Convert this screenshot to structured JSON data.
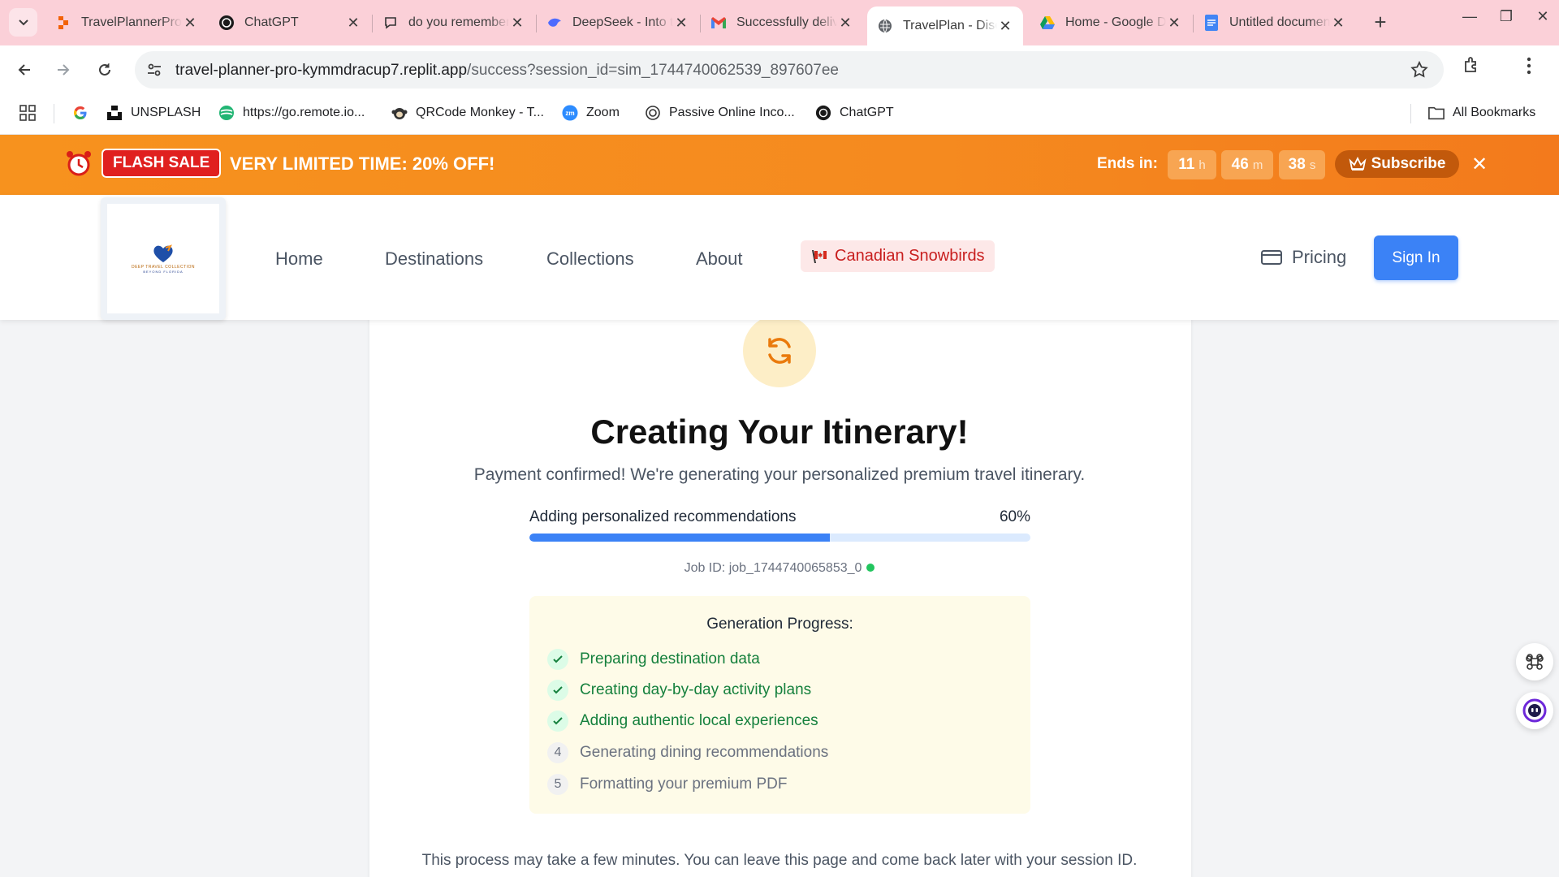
{
  "browser": {
    "tabs": [
      {
        "title": "TravelPlannerPro",
        "favicon": "replit-icon",
        "active": false
      },
      {
        "title": "ChatGPT",
        "favicon": "openai-icon",
        "active": false
      },
      {
        "title": "do you remember",
        "favicon": "chat-icon",
        "active": false
      },
      {
        "title": "DeepSeek - Into the Unknown",
        "favicon": "deepseek-icon",
        "active": false
      },
      {
        "title": "Successfully delivered",
        "favicon": "gmail-icon",
        "active": false
      },
      {
        "title": "TravelPlan - Discover",
        "favicon": "globe-icon",
        "active": true
      },
      {
        "title": "Home - Google Drive",
        "favicon": "drive-icon",
        "active": false
      },
      {
        "title": "Untitled document",
        "favicon": "docs-icon",
        "active": false
      }
    ],
    "url_host": "travel-planner-pro-kymmdracup7.replit.app",
    "url_path": "/success?session_id=sim_1744740062539_897607ee",
    "bookmarks": [
      {
        "label": "",
        "icon": "google-icon"
      },
      {
        "label": "UNSPLASH",
        "icon": "unsplash-icon"
      },
      {
        "label": "https://go.remote.io...",
        "icon": "remote-icon"
      },
      {
        "label": "QRCode Monkey - T...",
        "icon": "qrcode-monkey-icon"
      },
      {
        "label": "Zoom",
        "icon": "zoom-icon"
      },
      {
        "label": "Passive Online Inco...",
        "icon": "openai-icon"
      },
      {
        "label": "ChatGPT",
        "icon": "openai-icon"
      }
    ],
    "all_bookmarks": "All Bookmarks"
  },
  "flash": {
    "badge": "FLASH SALE",
    "message": "VERY LIMITED TIME:  20% OFF!",
    "ends_in": "Ends in:",
    "countdown": [
      {
        "value": "11",
        "unit": "h"
      },
      {
        "value": "46",
        "unit": "m"
      },
      {
        "value": "38",
        "unit": "s"
      }
    ],
    "subscribe": "Subscribe"
  },
  "header": {
    "logo_caption": "DEEP TRAVEL COLLECTION",
    "logo_caption2": "BEYOND FLORIDA",
    "nav": [
      "Home",
      "Destinations",
      "Collections",
      "About"
    ],
    "snowbirds": "Canadian Snowbirds",
    "pricing": "Pricing",
    "signin": "Sign In"
  },
  "main": {
    "title": "Creating Your Itinerary!",
    "lead": "Payment confirmed! We're generating your personalized premium travel itinerary.",
    "progress_label": "Adding personalized recommendations",
    "progress_value": 0.6,
    "progress_text": "60%",
    "job_id": "Job ID: job_1744740065853_0",
    "gen_title": "Generation Progress:",
    "steps": [
      {
        "marker": "✓",
        "label": "Preparing destination data",
        "done": true
      },
      {
        "marker": "✓",
        "label": "Creating day-by-day activity plans",
        "done": true
      },
      {
        "marker": "✓",
        "label": "Adding authentic local experiences",
        "done": true
      },
      {
        "marker": "4",
        "label": "Generating dining recommendations",
        "done": false
      },
      {
        "marker": "5",
        "label": "Formatting your premium PDF",
        "done": false
      }
    ],
    "note": "This process may take a few minutes. You can leave this page and come back later with your session ID."
  },
  "colors": {
    "accent": "#3b82f6",
    "flash_orange": "#f7921e",
    "success_green": "#15803d",
    "tab_strip": "#fbd0d8"
  }
}
